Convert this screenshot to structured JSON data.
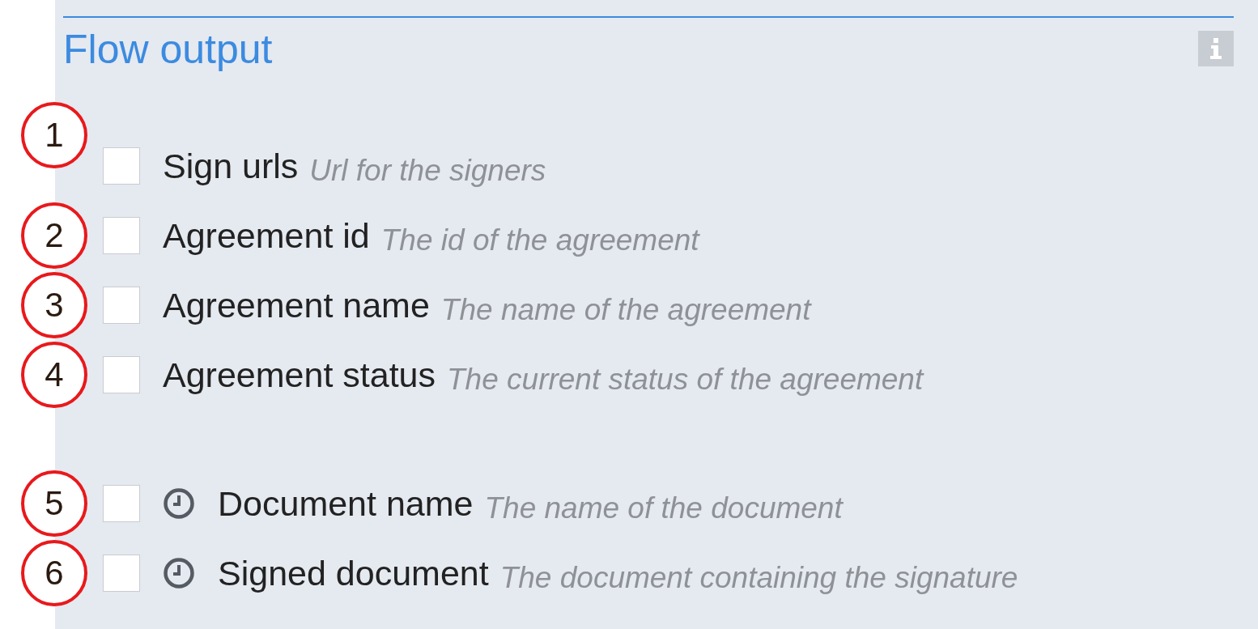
{
  "panel": {
    "title": "Flow output"
  },
  "groups": [
    {
      "items": [
        {
          "number": "1",
          "kind": "plain",
          "checked": false,
          "label": "Sign urls",
          "description": "Url for the signers"
        },
        {
          "number": "2",
          "kind": "plain",
          "checked": false,
          "label": "Agreement id",
          "description": "The id of the agreement"
        },
        {
          "number": "3",
          "kind": "plain",
          "checked": false,
          "label": "Agreement name",
          "description": "The name of the agreement"
        },
        {
          "number": "4",
          "kind": "plain",
          "checked": false,
          "label": "Agreement status",
          "description": "The current status of the agreement"
        }
      ]
    },
    {
      "items": [
        {
          "number": "5",
          "kind": "clock",
          "checked": false,
          "label": "Document name",
          "description": "The name of the document"
        },
        {
          "number": "6",
          "kind": "clock",
          "checked": false,
          "label": "Signed document",
          "description": "The document containing the signature"
        }
      ]
    }
  ]
}
